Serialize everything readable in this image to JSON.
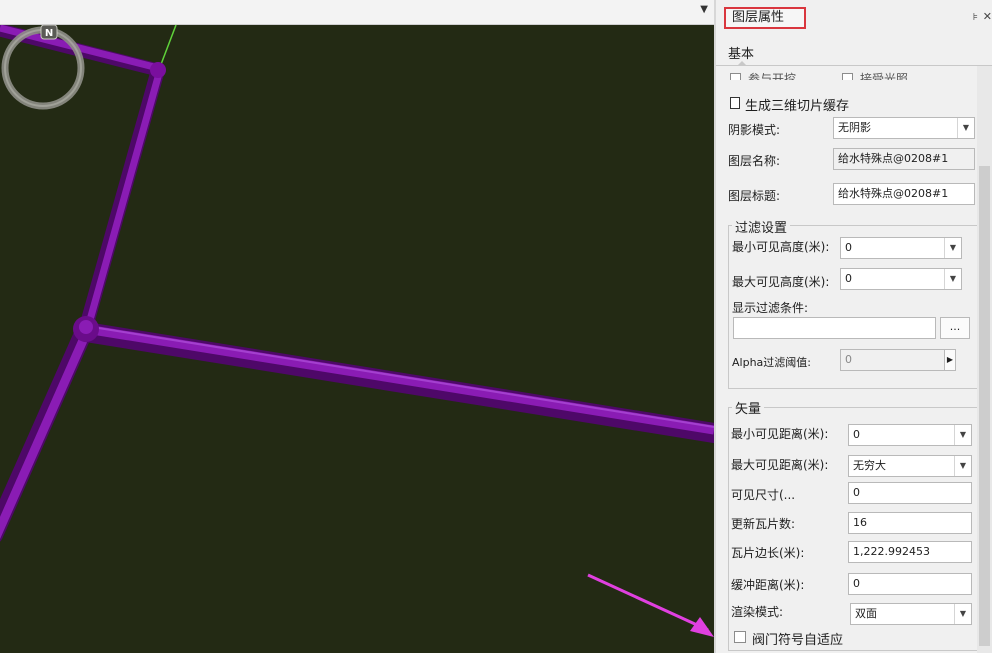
{
  "viewport": {
    "compass_letter": "N",
    "pipe_color": "#7a0f9e",
    "background_color": "#232a14"
  },
  "panel": {
    "title": "图层属性",
    "pin_icon": "pin-icon",
    "close_icon": "close-icon",
    "tab_basic": "基本",
    "partial_row": {
      "left": "参与开挖",
      "right": "接受光照"
    },
    "gen_3d_tile_cache": "生成三维切片缓存",
    "shadow_mode": {
      "label": "阴影模式:",
      "value": "无阴影"
    },
    "layer_name": {
      "label": "图层名称:",
      "value": "给水特殊点@0208#1"
    },
    "layer_title": {
      "label": "图层标题:",
      "value": "给水特殊点@0208#1"
    },
    "filter": {
      "group_title": "过滤设置",
      "min_height": {
        "label": "最小可见高度(米):",
        "value": "0"
      },
      "max_height": {
        "label": "最大可见高度(米):",
        "value": "0"
      },
      "display_condition": {
        "label": "显示过滤条件:",
        "value": "",
        "button": "..."
      },
      "alpha": {
        "label": "Alpha过滤阈值:",
        "value": "0"
      }
    },
    "vector": {
      "group_title": "矢量",
      "min_distance": {
        "label": "最小可见距离(米):",
        "value": "0"
      },
      "max_distance": {
        "label": "最大可见距离(米):",
        "value": "无穷大"
      },
      "visible_size": {
        "label": "可见尺寸(...",
        "value": "0"
      },
      "update_tiles": {
        "label": "更新瓦片数:",
        "value": "16"
      },
      "tile_edge": {
        "label": "瓦片边长(米):",
        "value": "1,222.992453"
      },
      "buffer_distance": {
        "label": "缓冲距离(米):",
        "value": "0"
      },
      "render_mode": {
        "label": "渲染模式:",
        "value": "双面"
      },
      "valve_adaptive": "阀门符号自适应"
    }
  },
  "annotation": {
    "arrow_color": "#e040e0",
    "highlight_color": "#d9363e"
  }
}
